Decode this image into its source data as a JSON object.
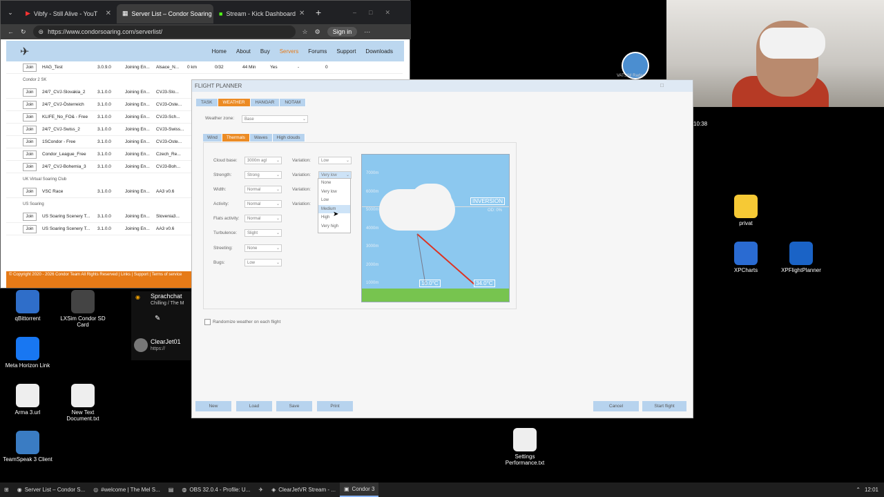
{
  "browser": {
    "tabs": [
      {
        "label": "Vibfy - Still Alive - YouT"
      },
      {
        "label": "Server List – Condor Soaring"
      },
      {
        "label": "Stream - Kick Dashboard"
      }
    ],
    "url": "https://www.condorsoaring.com/serverlist/",
    "signin": "Sign in",
    "nav": [
      "Home",
      "About",
      "Buy",
      "Servers",
      "Forums",
      "Support",
      "Downloads"
    ],
    "rows": [
      {
        "type": "row",
        "join": "Join",
        "name": "HAG_Test",
        "ver": "3.0.9.0",
        "status": "Joining En...",
        "loc": "Alsace_N...",
        "dist": "0 km",
        "pl": "0/32",
        "time": "44 Min",
        "flag": "Yes",
        "dash": "-",
        "num": "0"
      },
      {
        "type": "group",
        "label": "Condor 2 SK"
      },
      {
        "type": "row",
        "join": "Join",
        "name": "24/7_CVJ-Slovakia_2",
        "ver": "3.1.0.0",
        "status": "Joining En...",
        "loc": "CVJ3-Slo..."
      },
      {
        "type": "row",
        "join": "Join",
        "name": "24/7_CVJ-Österreich",
        "ver": "3.1.0.0",
        "status": "Joining En...",
        "loc": "CVJ3-Oste..."
      },
      {
        "type": "row",
        "join": "Join",
        "name": "KLIFE_No_FO& - Free",
        "ver": "3.1.0.0",
        "status": "Joining En...",
        "loc": "CVJ3-Sch..."
      },
      {
        "type": "row",
        "join": "Join",
        "name": "24/7_CVJ-Swiss_2",
        "ver": "3.1.0.0",
        "status": "Joining En...",
        "loc": "CVJ3-Swiss..."
      },
      {
        "type": "row",
        "join": "Join",
        "name": "1SCondor - Free",
        "ver": "3.1.0.0",
        "status": "Joining En...",
        "loc": "CVJ3-Oste..."
      },
      {
        "type": "row",
        "join": "Join",
        "name": "Condor_League_Free",
        "ver": "3.1.0.0",
        "status": "Joining En...",
        "loc": "Czech_Re..."
      },
      {
        "type": "row",
        "join": "Join",
        "name": "24/7_CVJ-Bohemia_3",
        "ver": "3.1.0.0",
        "status": "Joining En...",
        "loc": "CVJ3-Boh..."
      },
      {
        "type": "group",
        "label": "UK Virtual Soaring Club"
      },
      {
        "type": "row",
        "join": "Join",
        "name": "VSC Race",
        "ver": "3.1.0.0",
        "status": "Joining En...",
        "loc": "AA3 v0.6"
      },
      {
        "type": "group",
        "label": "US Soaring"
      },
      {
        "type": "row",
        "join": "Join",
        "name": "US Soaring Scenery T...",
        "ver": "3.1.0.0",
        "status": "Joining En...",
        "loc": "Slovenia3..."
      },
      {
        "type": "row",
        "join": "Join",
        "name": "US Soaring Scenery T...",
        "ver": "3.1.0.0",
        "status": "Joining En...",
        "loc": "AA3 v0.6"
      }
    ],
    "footer": "© Copyright 2020 - 2026 Condor Team All Rights Reserved | Links | Support | Terms of service"
  },
  "planner": {
    "title": "FLIGHT PLANNER",
    "tabs": [
      "TASK",
      "WEATHER",
      "HANGAR",
      "NOTAM"
    ],
    "weather_zone_label": "Weather zone:",
    "weather_zone": "Base",
    "subtabs": [
      "Wind",
      "Thermals",
      "Waves",
      "High clouds"
    ],
    "fields": [
      {
        "label": "Cloud base:",
        "value": "3000m agl",
        "var_label": "Variation:",
        "var": "Low"
      },
      {
        "label": "Strength:",
        "value": "Strong",
        "var_label": "Variation:",
        "var": "Very low"
      },
      {
        "label": "Width:",
        "value": "Normal",
        "var_label": "Variation:",
        "var": ""
      },
      {
        "label": "Activity:",
        "value": "Normal",
        "var_label": "Variation:",
        "var": ""
      },
      {
        "label": "Flats activity:",
        "value": "Normal"
      },
      {
        "label": "Turbulence:",
        "value": "Slight"
      },
      {
        "label": "Streeting:",
        "value": "None"
      },
      {
        "label": "Bugs:",
        "value": "Low"
      }
    ],
    "dropdown": [
      "None",
      "Very low",
      "Low",
      "Medium",
      "High",
      "Very high"
    ],
    "chart": {
      "alt_labels": [
        "7000m",
        "6000m",
        "5000m",
        "4000m",
        "3000m",
        "2000m",
        "1000m"
      ],
      "inversion": "INVERSION",
      "od": "OD: 0%",
      "temp_left": "10.0°C",
      "temp_right": "34.0°C"
    },
    "randomize": "Randomize weather on each flight",
    "buttons": {
      "new": "New",
      "load": "Load",
      "save": "Save",
      "print": "Print",
      "cancel": "Cancel",
      "start": "Start flight"
    }
  },
  "desktop": {
    "icons": [
      {
        "label": "qBittorrent",
        "color": "#2f6ec9"
      },
      {
        "label": "LXSim Condor SD Card",
        "color": "#444"
      },
      {
        "label": "Meta Horizon Link",
        "color": "#1877f2"
      },
      {
        "label": "Arma 3.url",
        "color": "#eee"
      },
      {
        "label": "New Text Document.txt",
        "color": "#eee"
      },
      {
        "label": "TeamSpeak 3 Client",
        "color": "#3a7cc3"
      },
      {
        "label": "privat",
        "color": "#f6c935"
      },
      {
        "label": "XPCharts",
        "color": "#2a6bd2"
      },
      {
        "label": "XPFlightPlanner",
        "color": "#1a63c6"
      },
      {
        "label": "Settings Performance.txt",
        "color": "#eee"
      }
    ],
    "vatsim": "VATSIM Radar",
    "clock_small": "10:38",
    "sprach_title": "Sprachchat",
    "sprach_sub": "Chilling / The M",
    "clearjet": "ClearJet01",
    "clearjet_sub": "https://"
  },
  "taskbar": {
    "items": [
      "Server List – Condor S...",
      "#welcome | The Mel S...",
      "OBS 32.0.4 - Profile: U...",
      "ClearJetVR Stream - ...",
      "Condor 3"
    ],
    "time": "12:01"
  }
}
